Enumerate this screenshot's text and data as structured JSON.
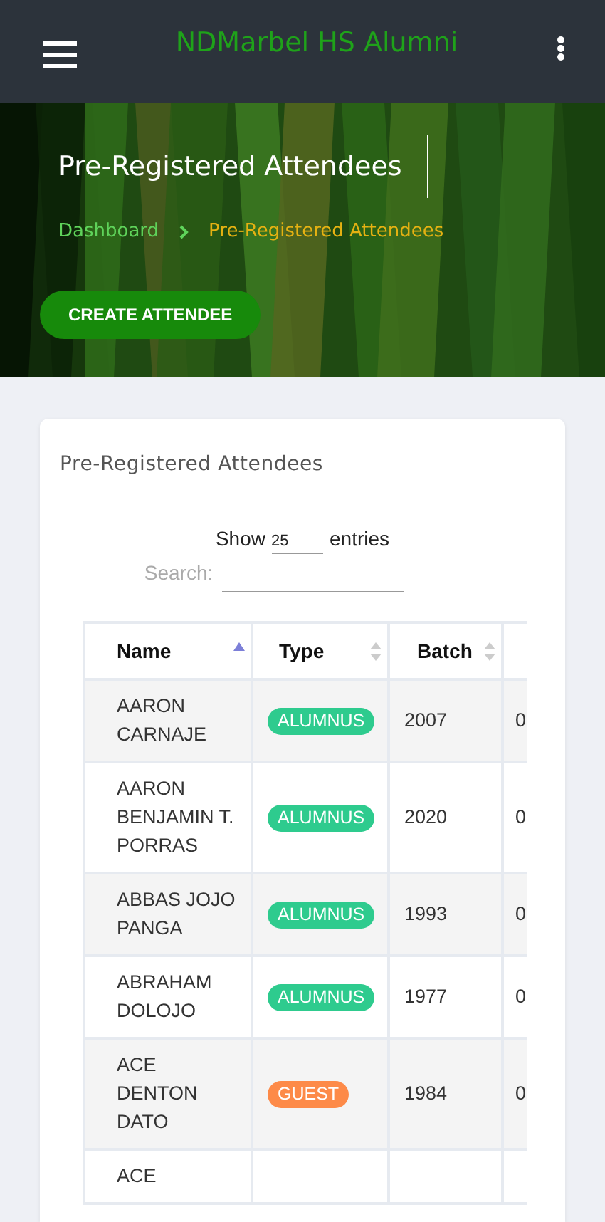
{
  "app_bar": {
    "title": "NDMarbel HS Alumni"
  },
  "hero": {
    "title": "Pre-Registered Attendees",
    "breadcrumb": [
      {
        "label": "Dashboard",
        "current": false
      },
      {
        "label": "Pre-Registered Attendees",
        "current": true
      }
    ],
    "button": "CREATE ATTENDEE"
  },
  "card": {
    "title": "Pre-Registered Attendees",
    "show_label": "Show",
    "page_size": "25",
    "entries_label": "entries",
    "search_label": "Search:"
  },
  "table": {
    "columns": [
      {
        "label": "Name",
        "sorted": true
      },
      {
        "label": "Type",
        "sorted": false
      },
      {
        "label": "Batch",
        "sorted": false
      }
    ],
    "rows": [
      {
        "name": "AARON CARNAJE",
        "type": "ALUMNUS",
        "color": "#2ecb8e",
        "batch": "2007",
        "column_4": "0"
      },
      {
        "name": "AARON BENJAMIN T. PORRAS",
        "type": "ALUMNUS",
        "color": "#2ecb8e",
        "batch": "2020",
        "column_4": "0"
      },
      {
        "name": "ABBAS JOJO PANGA",
        "type": "ALUMNUS",
        "color": "#2ecb8e",
        "batch": "1993",
        "column_4": "0"
      },
      {
        "name": "ABRAHAM DOLOJO",
        "type": "ALUMNUS",
        "color": "#2ecb8e",
        "batch": "1977",
        "column_4": "0"
      },
      {
        "name": "ACE DENTON DATO",
        "type": "GUEST",
        "color": "#fd8a48",
        "batch": "1984",
        "column_4": "0"
      },
      {
        "name": "ACE"
      }
    ]
  }
}
